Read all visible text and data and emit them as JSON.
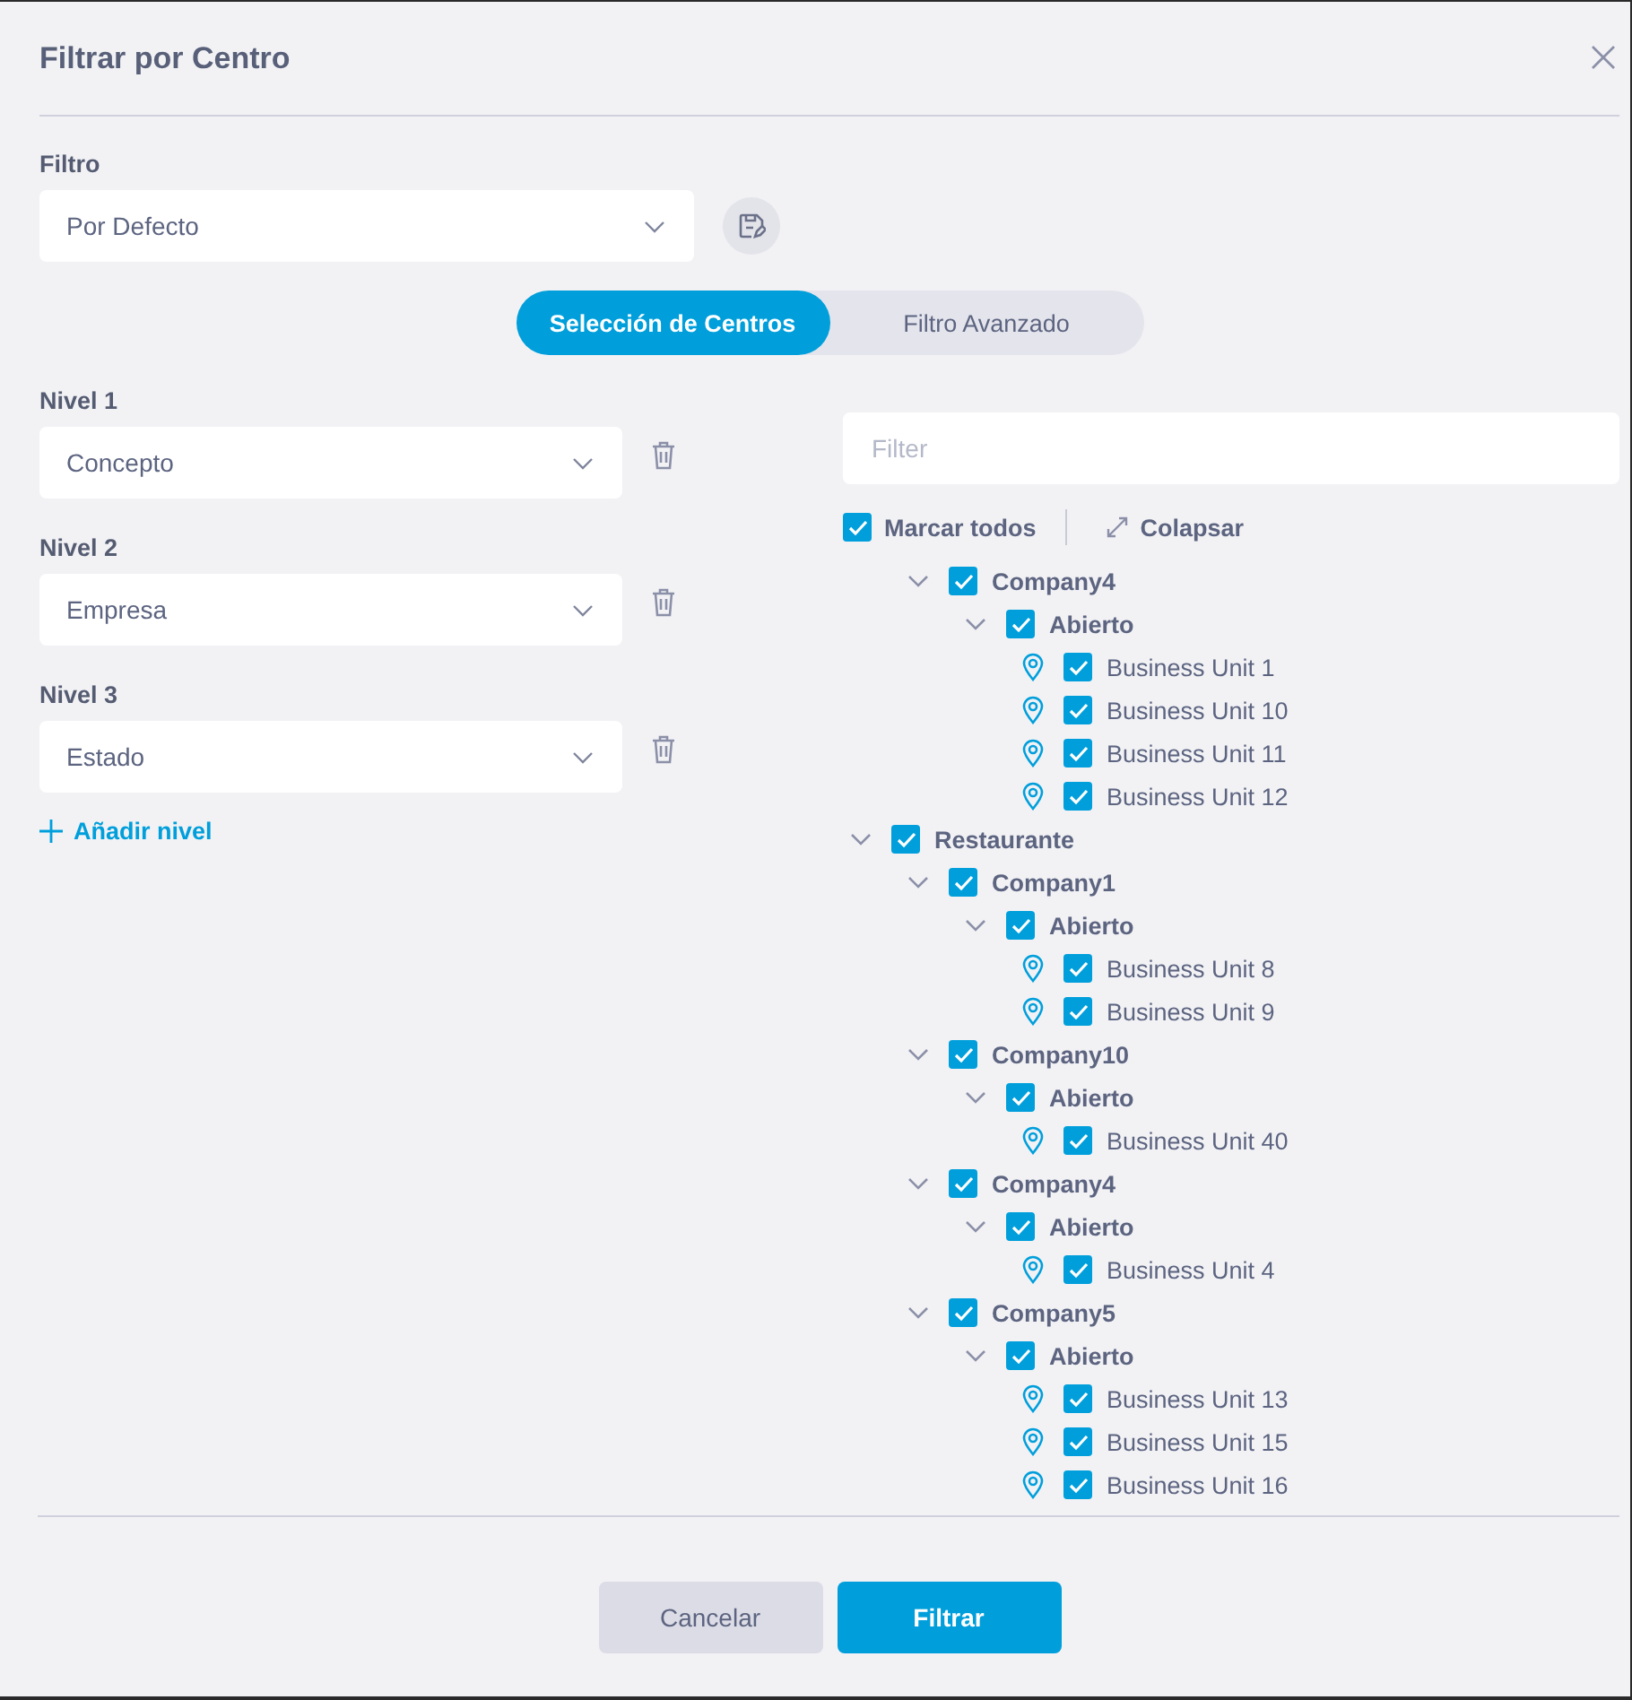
{
  "dialog": {
    "title": "Filtrar por Centro"
  },
  "filter": {
    "label": "Filtro",
    "value": "Por Defecto"
  },
  "tabs": [
    {
      "label": "Selección de Centros",
      "selected": true
    },
    {
      "label": "Filtro Avanzado",
      "selected": false
    }
  ],
  "levels": [
    {
      "label": "Nivel 1",
      "value": "Concepto"
    },
    {
      "label": "Nivel 2",
      "value": "Empresa"
    },
    {
      "label": "Nivel 3",
      "value": "Estado"
    }
  ],
  "add_level": "Añadir nivel",
  "tree_filter": {
    "placeholder": "Filter"
  },
  "select_all": {
    "label": "Marcar todos",
    "checked": true
  },
  "collapse": "Colapsar",
  "tree": [
    {
      "children": [
        {
          "label": "Company4",
          "checked": true,
          "expanded": true,
          "children": [
            {
              "label": "Abierto",
              "checked": true,
              "expanded": true,
              "children": [
                {
                  "label": "Business Unit 1",
                  "checked": true
                },
                {
                  "label": "Business Unit 10",
                  "checked": true
                },
                {
                  "label": "Business Unit 11",
                  "checked": true
                },
                {
                  "label": "Business Unit 12",
                  "checked": true
                }
              ]
            }
          ]
        }
      ]
    },
    {
      "label": "Restaurante",
      "checked": true,
      "expanded": true,
      "children": [
        {
          "label": "Company1",
          "checked": true,
          "expanded": true,
          "children": [
            {
              "label": "Abierto",
              "checked": true,
              "expanded": true,
              "children": [
                {
                  "label": "Business Unit 8",
                  "checked": true
                },
                {
                  "label": "Business Unit 9",
                  "checked": true
                }
              ]
            }
          ]
        },
        {
          "label": "Company10",
          "checked": true,
          "expanded": true,
          "children": [
            {
              "label": "Abierto",
              "checked": true,
              "expanded": true,
              "children": [
                {
                  "label": "Business Unit 40",
                  "checked": true
                }
              ]
            }
          ]
        },
        {
          "label": "Company4",
          "checked": true,
          "expanded": true,
          "children": [
            {
              "label": "Abierto",
              "checked": true,
              "expanded": true,
              "children": [
                {
                  "label": "Business Unit 4",
                  "checked": true
                }
              ]
            }
          ]
        },
        {
          "label": "Company5",
          "checked": true,
          "expanded": true,
          "children": [
            {
              "label": "Abierto",
              "checked": true,
              "expanded": true,
              "children": [
                {
                  "label": "Business Unit 13",
                  "checked": true
                },
                {
                  "label": "Business Unit 15",
                  "checked": true
                },
                {
                  "label": "Business Unit 16",
                  "checked": true
                }
              ]
            }
          ]
        }
      ]
    }
  ],
  "buttons": [
    {
      "label": "Cancelar",
      "kind": "secondary"
    },
    {
      "label": "Filtrar",
      "kind": "primary"
    }
  ]
}
